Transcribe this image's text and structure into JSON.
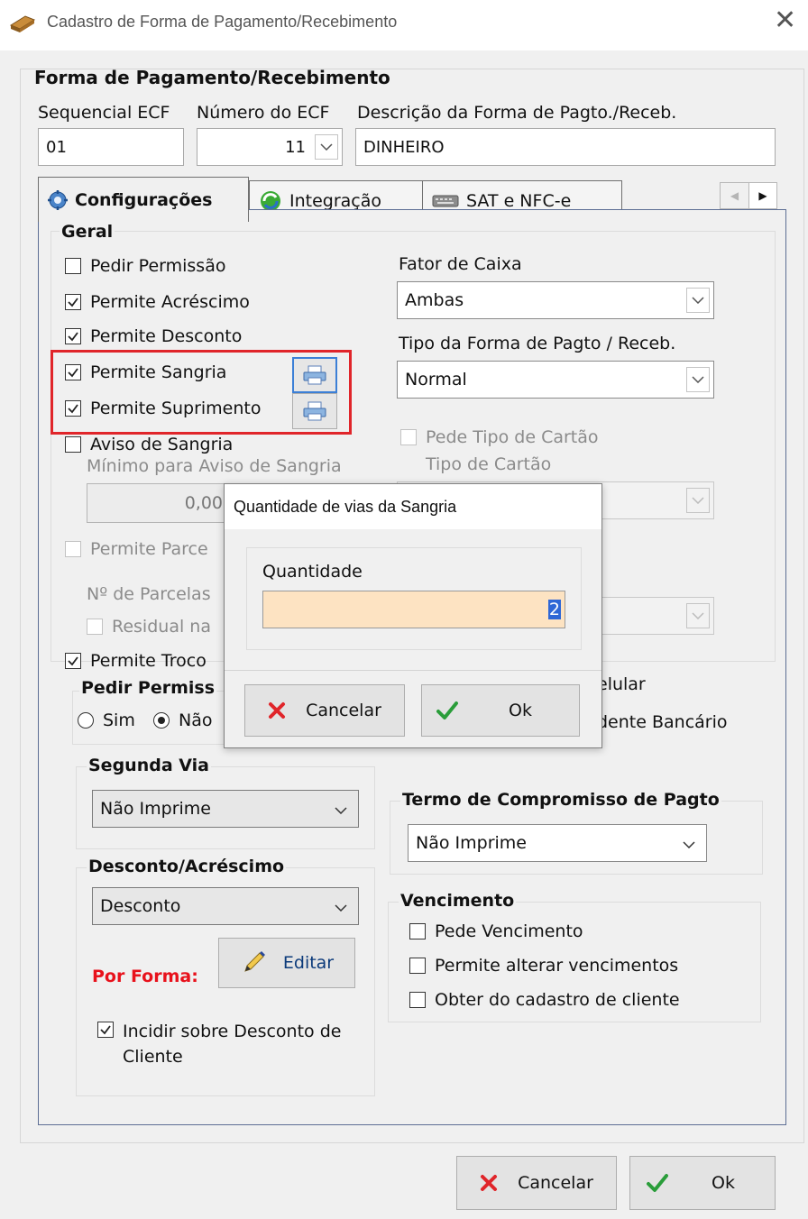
{
  "window": {
    "title": "Cadastro de Forma de Pagamento/Recebimento",
    "close_glyph": "✕"
  },
  "header": {
    "section_title": "Forma de Pagamento/Recebimento",
    "sequencial_label": "Sequencial ECF",
    "numero_label": "Número do ECF",
    "descricao_label": "Descrição da Forma de Pagto./Receb.",
    "sequencial_value": "01",
    "numero_value": "11",
    "descricao_value": "DINHEIRO"
  },
  "tabs": [
    {
      "label": "Configurações",
      "icon": "gear-icon"
    },
    {
      "label": "Integração",
      "icon": "sync-icon"
    },
    {
      "label": "SAT e NFC-e",
      "icon": "keyboard-icon"
    }
  ],
  "geral": {
    "title": "Geral",
    "pedir_permissao": "Pedir Permissão",
    "permite_acrescimo": "Permite Acréscimo",
    "permite_desconto": "Permite Desconto",
    "permite_sangria": "Permite Sangria",
    "permite_suprimento": "Permite Suprimento",
    "aviso_sangria": "Aviso de Sangria",
    "minimo_aviso": "Mínimo para Aviso de Sangria",
    "minimo_value": "0,00",
    "permite_parcelamento": "Permite Parce",
    "n_parcelas": "Nº de Parcelas",
    "residual": "Residual na",
    "permite_troco": "Permite Troco",
    "pedir_permissao_troco": "Pedir Permiss",
    "radio_sim": "Sim",
    "radio_nao": "Não"
  },
  "right": {
    "fator_caixa_label": "Fator de Caixa",
    "fator_caixa_value": "Ambas",
    "tipo_forma_label": "Tipo da Forma de Pagto / Receb.",
    "tipo_forma_value": "Normal",
    "pede_tipo_cartao": "Pede Tipo de Cartão",
    "tipo_cartao_label": "Tipo de Cartão",
    "celular_text": "elular",
    "bancario_text": "dente Bancário"
  },
  "segunda_via": {
    "title": "Segunda Via",
    "value": "Não Imprime"
  },
  "termo": {
    "title": "Termo de Compromisso de Pagto",
    "value": "Não Imprime"
  },
  "desconto": {
    "title": "Desconto/Acréscimo",
    "value": "Desconto",
    "por_forma": "Por Forma:",
    "editar": "Editar",
    "incidir": "Incidir sobre Desconto de Cliente"
  },
  "vencimento": {
    "title": "Vencimento",
    "pede": "Pede Vencimento",
    "permite_alterar": "Permite alterar vencimentos",
    "obter": "Obter do cadastro de cliente"
  },
  "footer": {
    "cancel": "Cancelar",
    "ok": "Ok"
  },
  "modal": {
    "title": "Quantidade de vias da Sangria",
    "quantidade_label": "Quantidade",
    "quantidade_value": "2",
    "cancel": "Cancelar",
    "ok": "Ok"
  },
  "colors": {
    "cancel_red": "#e0252a",
    "ok_green": "#2a9d3a",
    "por_forma_red": "#e8111b"
  }
}
